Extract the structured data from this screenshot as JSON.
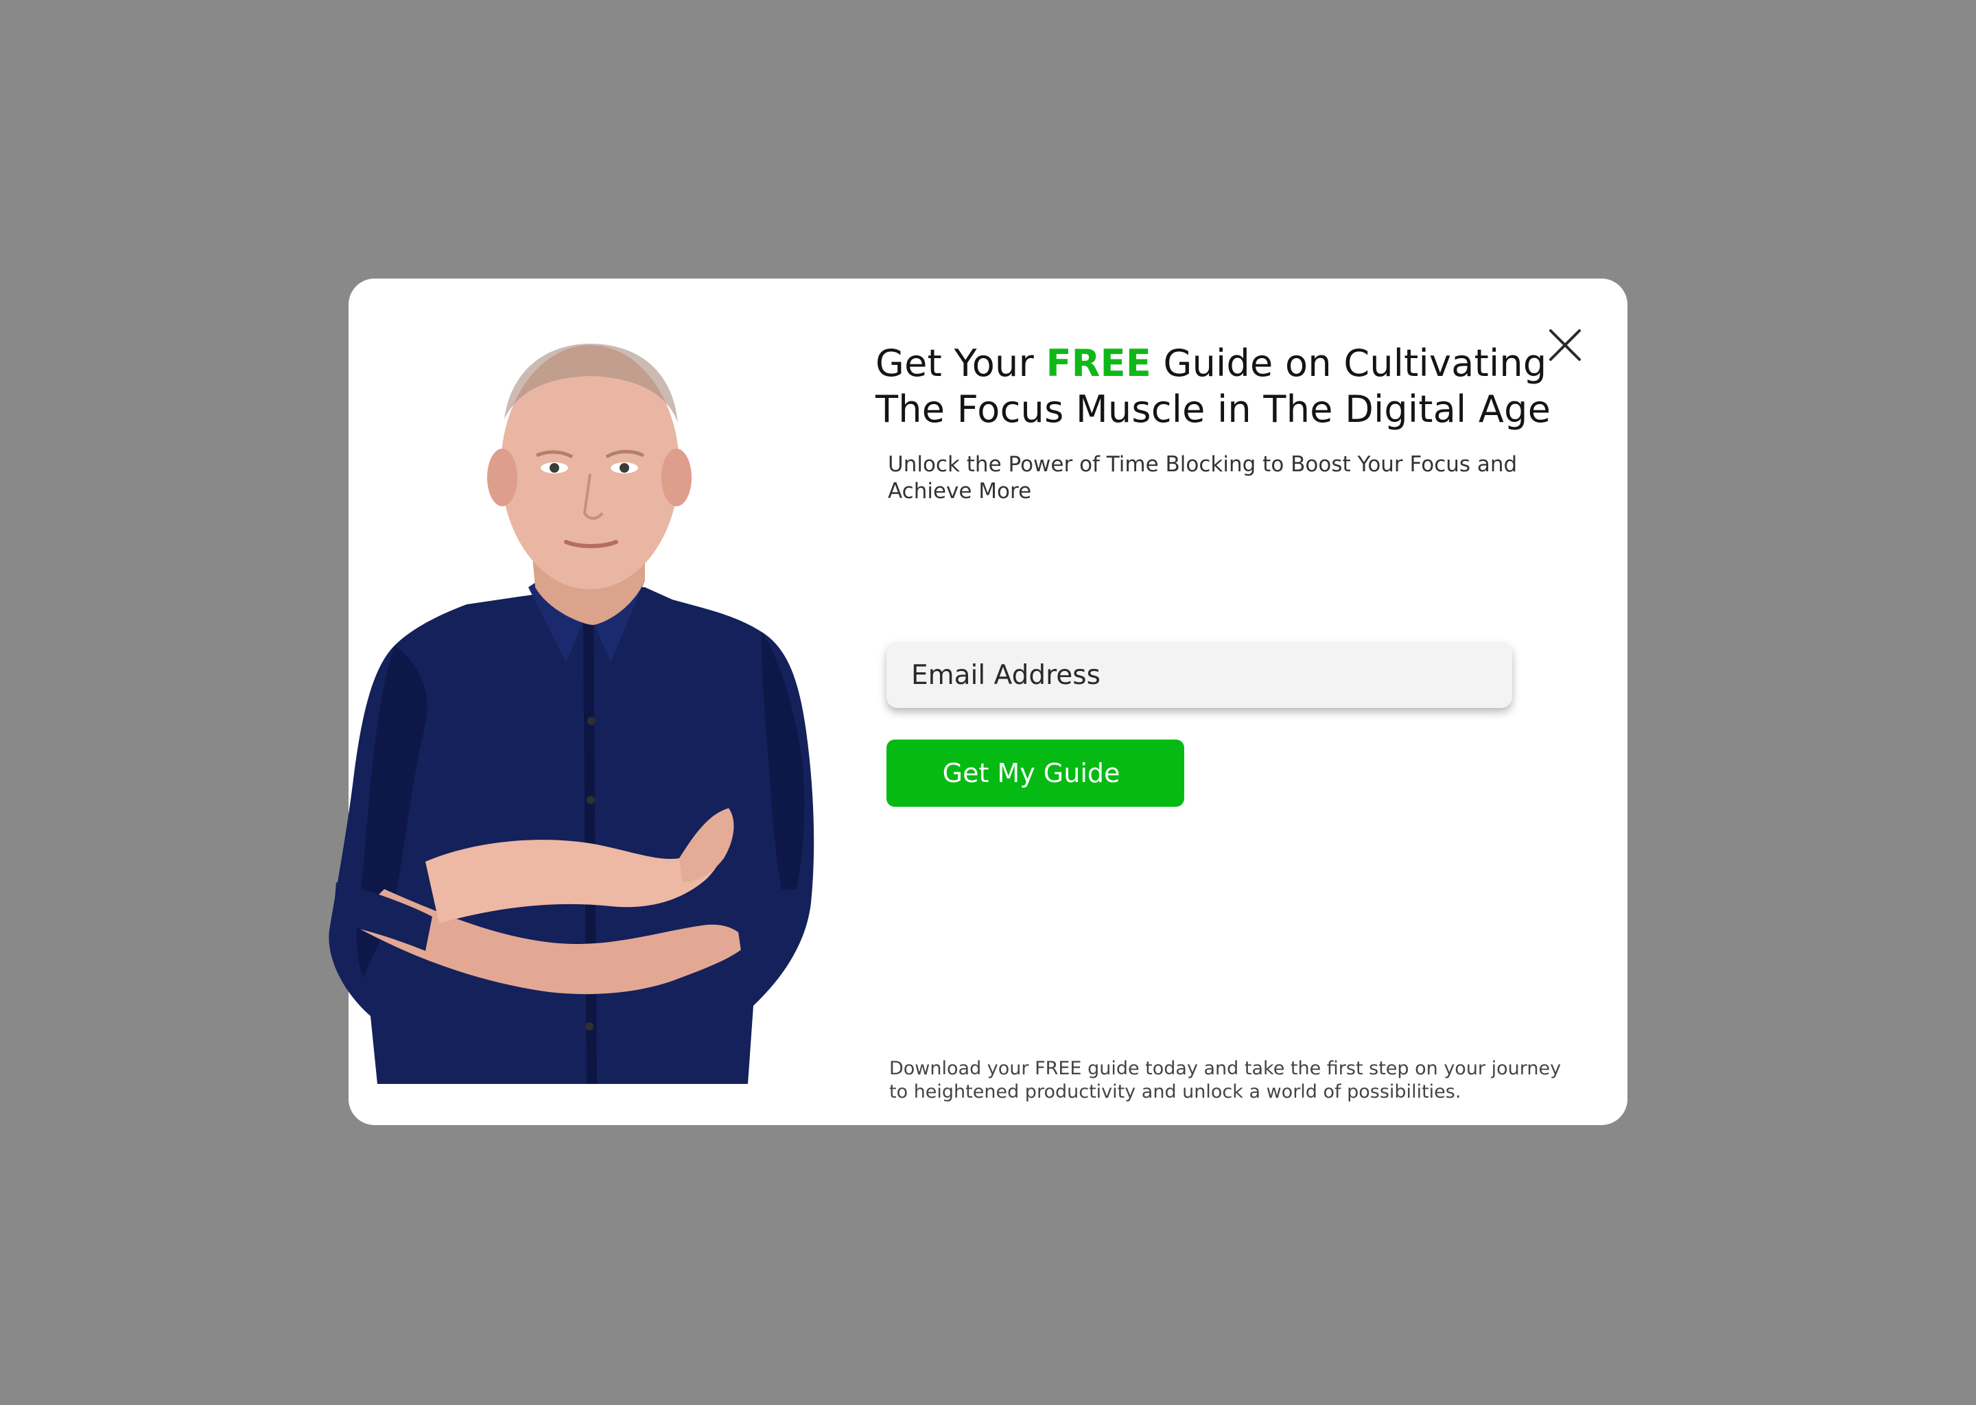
{
  "colors": {
    "backdrop": "#898989",
    "modal_background": "#ffffff",
    "accent_green": "#10b817",
    "button_green": "#05bb13",
    "input_background": "#f3f3f3"
  },
  "modal": {
    "close_icon": "close-icon",
    "headline": {
      "before": "Get Your ",
      "highlight": "FREE",
      "after": " Guide on Cultivating The Focus Muscle in The Digital Age"
    },
    "subheadline": "Unlock the Power of Time Blocking to Boost Your Focus and Achieve More",
    "email_input": {
      "placeholder": "Email Address",
      "value": ""
    },
    "cta_label": "Get My Guide",
    "footnote": "Download your FREE guide today and take the first step on your journey to heightened productivity and unlock a world of possibilities."
  },
  "portrait": {
    "description_icon": "person-portrait"
  }
}
